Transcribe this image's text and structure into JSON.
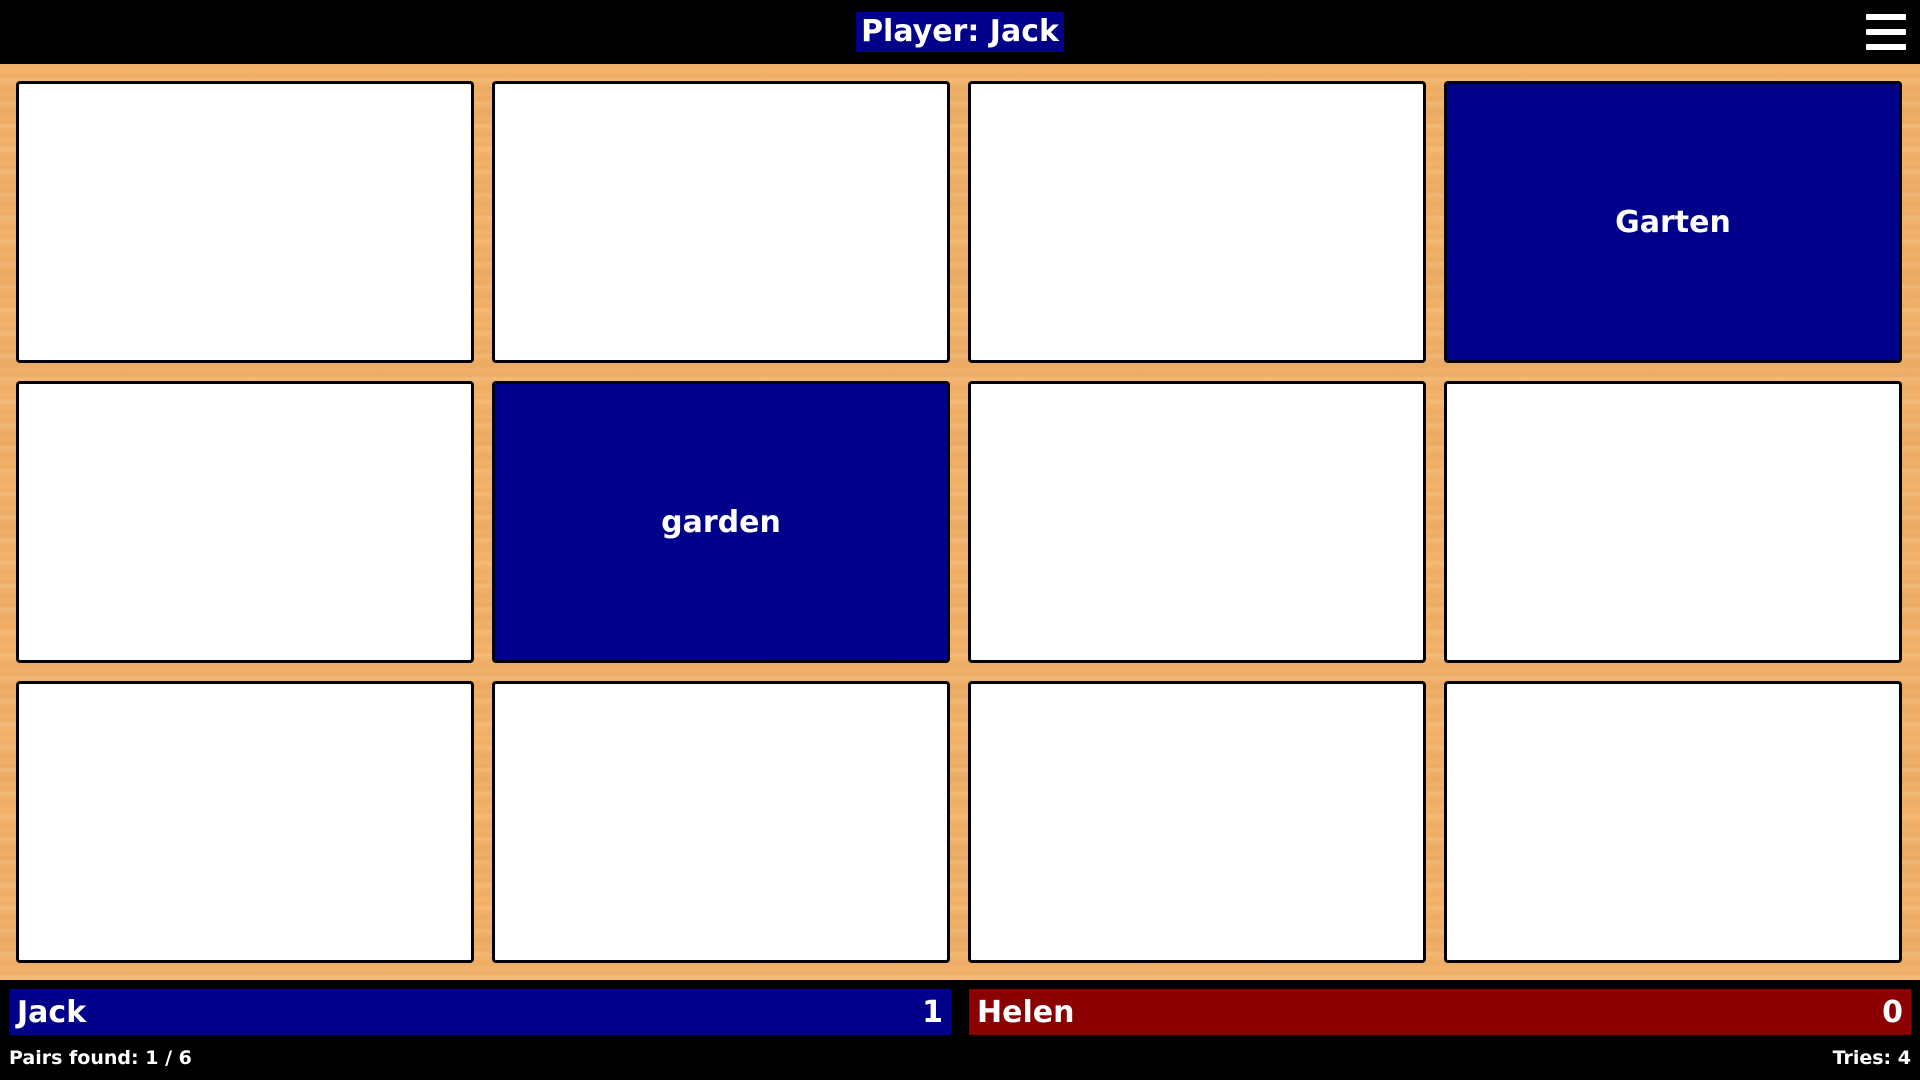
{
  "header": {
    "player_label": "Player: Jack",
    "menu_icon": "hamburger-menu-icon"
  },
  "colors": {
    "board": "#f4b46c",
    "card_back": "#ffffff",
    "card_revealed": "#00008b",
    "player1": "#00008b",
    "player2": "#8b0000"
  },
  "board": {
    "rows": 3,
    "columns": 4,
    "cards": [
      {
        "state": "hidden",
        "text": ""
      },
      {
        "state": "hidden",
        "text": ""
      },
      {
        "state": "hidden",
        "text": ""
      },
      {
        "state": "revealed",
        "text": "Garten"
      },
      {
        "state": "hidden",
        "text": ""
      },
      {
        "state": "revealed",
        "text": "garden"
      },
      {
        "state": "hidden",
        "text": ""
      },
      {
        "state": "hidden",
        "text": ""
      },
      {
        "state": "hidden",
        "text": ""
      },
      {
        "state": "hidden",
        "text": ""
      },
      {
        "state": "hidden",
        "text": ""
      },
      {
        "state": "hidden",
        "text": ""
      }
    ]
  },
  "players": [
    {
      "name": "Jack",
      "score": "1"
    },
    {
      "name": "Helen",
      "score": "0"
    }
  ],
  "status": {
    "pairs_found": "Pairs found: 1 / 6",
    "tries": "Tries: 4"
  }
}
